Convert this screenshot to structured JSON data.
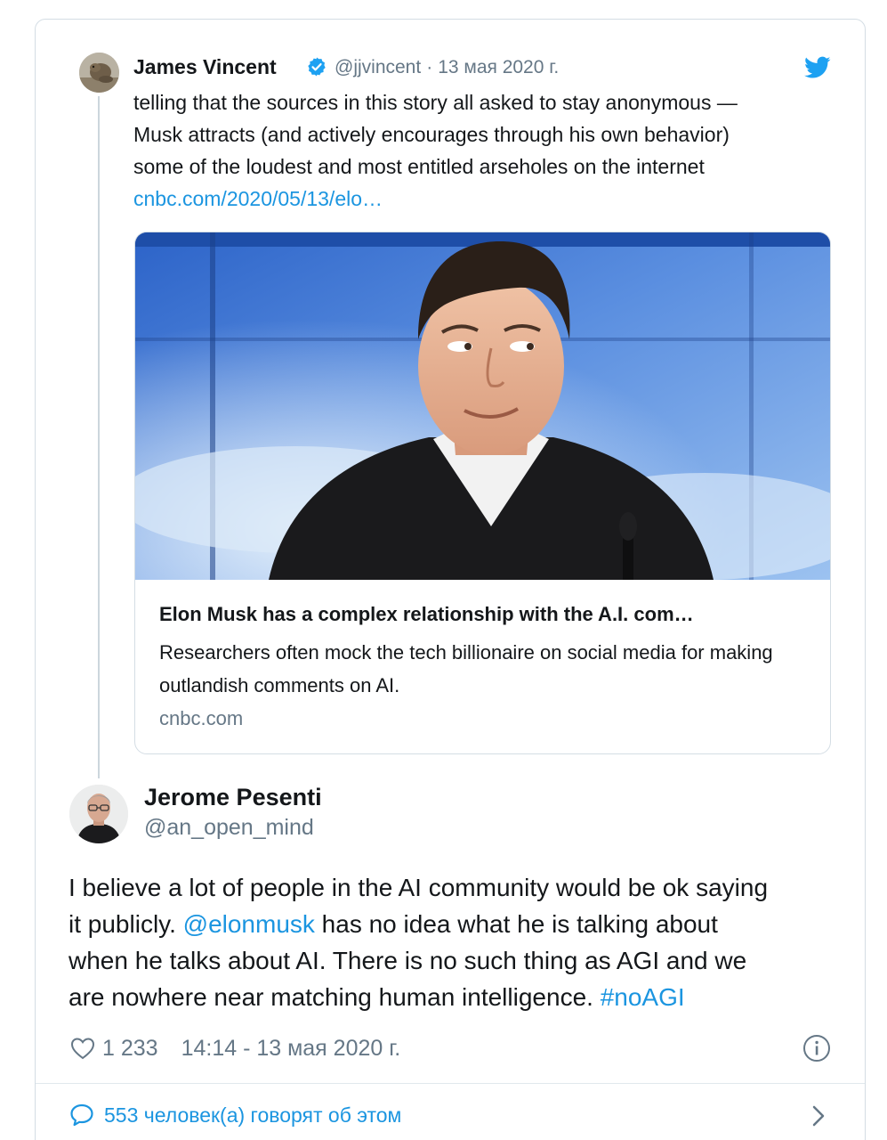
{
  "colors": {
    "link": "#1b95e0",
    "text": "#14171a",
    "muted": "#657786",
    "border": "#d4dde4",
    "verified": "#1da1f2"
  },
  "quoted_tweet": {
    "author_name": "James Vincent",
    "handle": "@jjvincent",
    "separator": "·",
    "date": "13 мая 2020 г.",
    "verified": true,
    "text_lines": [
      "telling that the sources in this story all asked to stay anonymous —",
      "Musk attracts (and actively encourages through his own behavior)",
      "some of the loudest and most entitled arseholes on the internet"
    ],
    "link_text": "cnbc.com/2020/05/13/elo…",
    "card": {
      "title": "Elon Musk has a complex relationship with the A.I. com…",
      "description": "Researchers often mock the tech billionaire on social media for making outlandish comments on AI.",
      "domain": "cnbc.com"
    }
  },
  "main_tweet": {
    "author_name": "Jerome Pesenti",
    "handle": "@an_open_mind",
    "line1": "I believe a lot of people in the AI community would be ok saying",
    "line2_pre": "it publicly. ",
    "mention": "@elonmusk",
    "line2_post": " has no idea what he is talking about",
    "line3": "when he talks about AI. There is no such thing as AGI and we",
    "line4_pre": "are nowhere near matching human intelligence. ",
    "hashtag": "#noAGI",
    "likes": "1 233",
    "time": "14:14 - 13 мая 2020 г.",
    "replies_label": "553 человек(а) говорят об этом"
  },
  "icons": {
    "verified": "verified-badge-icon",
    "brand": "twitter-bird-icon",
    "like": "heart-icon",
    "info": "info-icon",
    "reply": "speech-bubble-icon",
    "more": "chevron-right-icon"
  }
}
